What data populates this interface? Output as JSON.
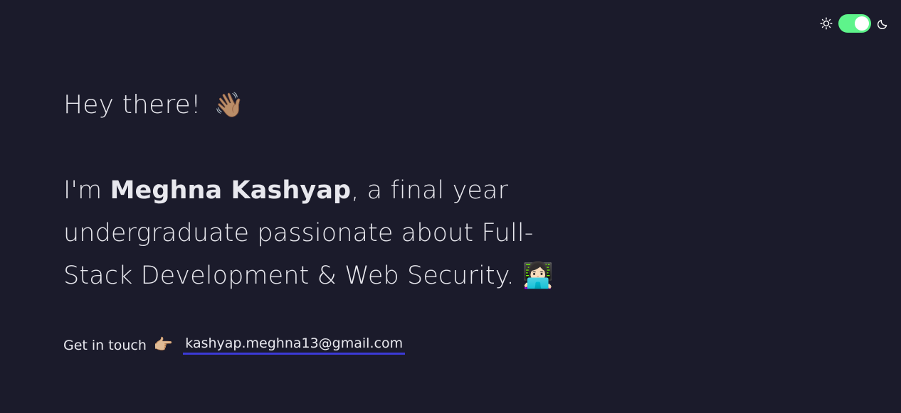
{
  "theme": {
    "accent_color": "#5ef48b",
    "underline_color": "#3b3ad6",
    "background_color": "#1b1b2b",
    "light_icon": "sun-icon",
    "dark_icon": "moon-icon",
    "mode": "dark"
  },
  "hero": {
    "greeting": "Hey there!",
    "greeting_emoji": "👋🏽",
    "intro_prefix": "I'm ",
    "name": "Meghna Kashyap",
    "intro_suffix": ", a final year undergraduate passionate about Full-Stack Development & Web Security.",
    "intro_emoji": "👩🏻‍💻"
  },
  "contact": {
    "label": "Get in touch",
    "label_emoji": "👉🏼",
    "email": "kashyap.meghna13@gmail.com"
  }
}
